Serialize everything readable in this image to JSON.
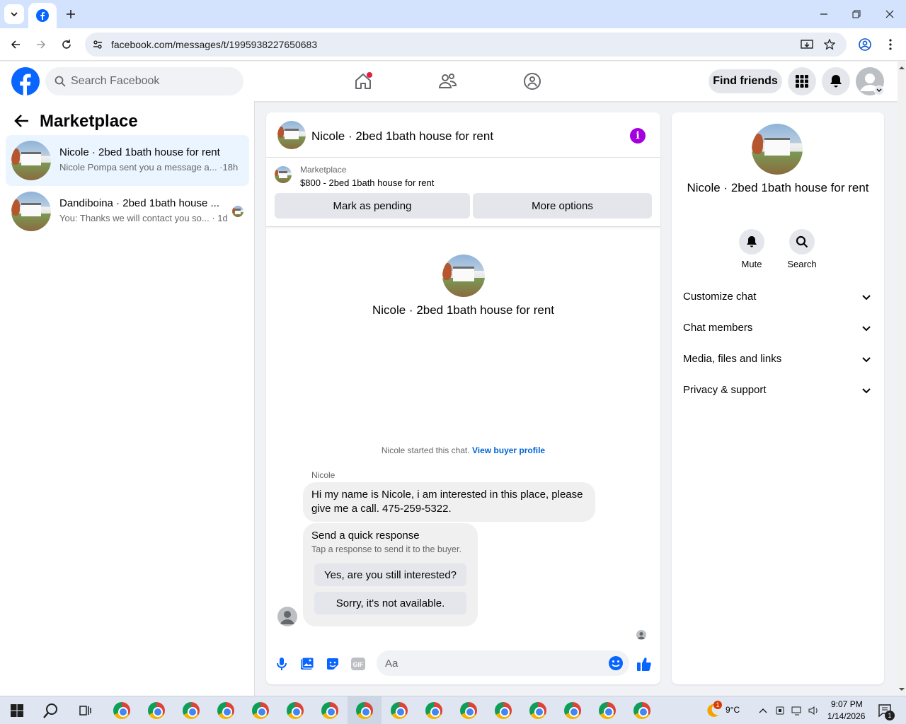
{
  "browser": {
    "url": "facebook.com/messages/t/1995938227650683"
  },
  "fb": {
    "search_placeholder": "Search Facebook",
    "find_friends": "Find friends"
  },
  "left": {
    "title": "Marketplace",
    "conversations": [
      {
        "name": "Nicole · 2bed 1bath house for rent",
        "preview": "Nicole Pompa sent you a message a... ·18h",
        "active": true
      },
      {
        "name": "Dandiboina · 2bed 1bath house ...",
        "preview": "You: Thanks we will contact you so... · 1d",
        "active": false
      }
    ]
  },
  "chat": {
    "title": "Nicole · 2bed 1bath house for rent",
    "listing_category": "Marketplace",
    "listing_price": "$800 - 2bed 1bath house for rent",
    "mark_pending": "Mark as pending",
    "more_options": "More options",
    "intro_name": "Nicole · 2bed 1bath house for rent",
    "started_text": "Nicole started this chat.",
    "view_buyer": "View buyer profile",
    "sender": "Nicole",
    "message": "Hi my name is Nicole, i am interested in this place, please give me a call. 475-259-5322.",
    "quick_title": "Send a quick response",
    "quick_sub": "Tap a response to send it to the buyer.",
    "quick_1": "Yes, are you still interested?",
    "quick_2": "Sorry, it's not available.",
    "input_placeholder": "Aa"
  },
  "right": {
    "name": "Nicole · 2bed 1bath house for rent",
    "mute": "Mute",
    "search": "Search",
    "sections": [
      "Customize chat",
      "Chat members",
      "Media, files and links",
      "Privacy & support"
    ]
  },
  "taskbar": {
    "weather_temp": "9°C",
    "weather_badge": "1",
    "time": "9:07 PM",
    "date": "1/14/2026",
    "notif_count": "1"
  },
  "colors": {
    "fb_blue": "#0866ff",
    "link_blue": "#0064d1",
    "info_purple": "#a300e0",
    "active_row": "#ebf5ff"
  }
}
